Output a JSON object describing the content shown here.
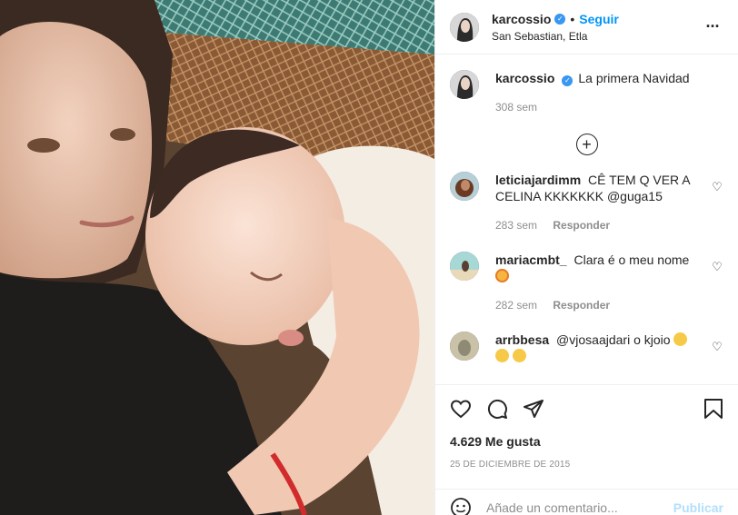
{
  "post": {
    "username": "karcossio",
    "follow_label": "Seguir",
    "location": "San Sebastian, Etla",
    "caption_text": "La primera Navidad",
    "caption_time": "308 sem",
    "likes": "4.629 Me gusta",
    "date": "25 DE DICIEMBRE DE 2015"
  },
  "comments": [
    {
      "username": "leticiajardimm",
      "text": "CÊ TEM Q VER A CELINA KKKKKKK @guga15",
      "time": "283 sem",
      "reply_label": "Responder"
    },
    {
      "username": "mariacmbt_",
      "text": "Clara é o meu nome",
      "time": "282 sem",
      "reply_label": "Responder"
    },
    {
      "username": "arrbbesa",
      "text": "@vjosaajdari o kjoio",
      "time": "",
      "reply_label": ""
    }
  ],
  "add_comment": {
    "placeholder": "Añade un comentario...",
    "publish_label": "Publicar"
  },
  "icons": {
    "verified": "verified-badge-icon",
    "more": "more-options-icon",
    "load_more": "plus-circle-icon",
    "like": "heart-icon",
    "comment": "comment-bubble-icon",
    "share": "paper-plane-icon",
    "save": "bookmark-icon",
    "emoji": "smiley-icon"
  },
  "colors": {
    "accent": "#0095f6",
    "verified": "#3897f0",
    "publish_disabled": "#b2dffc",
    "muted": "#8e8e8e"
  }
}
